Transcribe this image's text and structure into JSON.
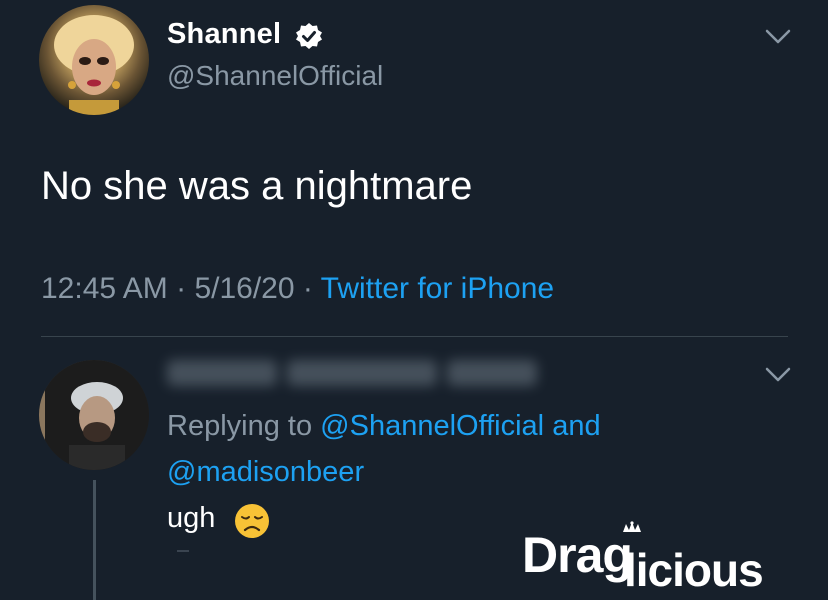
{
  "tweet": {
    "author": {
      "display_name": "Shannel",
      "handle": "@ShannelOfficial",
      "verified": true,
      "avatar_icon": "drag-queen-avatar"
    },
    "text": "No she was a nightmare",
    "time": "12:45 AM",
    "separator": " · ",
    "date": "5/16/20",
    "source": "Twitter for iPhone"
  },
  "reply": {
    "avatar_icon": "man-hat-avatar",
    "replying_prefix": "Replying to ",
    "mention_1": "@ShannelOfficial",
    "conjunction": " and",
    "mention_2": "@madisonbeer",
    "text": "ugh",
    "emoji_icon": "disappointed-face-emoji"
  },
  "watermark": {
    "brand": "Draglicious"
  },
  "colors": {
    "background": "#17202b",
    "text_primary": "#ffffff",
    "text_secondary": "#8a98a5",
    "link": "#1da1f2",
    "divider": "#38444d"
  }
}
